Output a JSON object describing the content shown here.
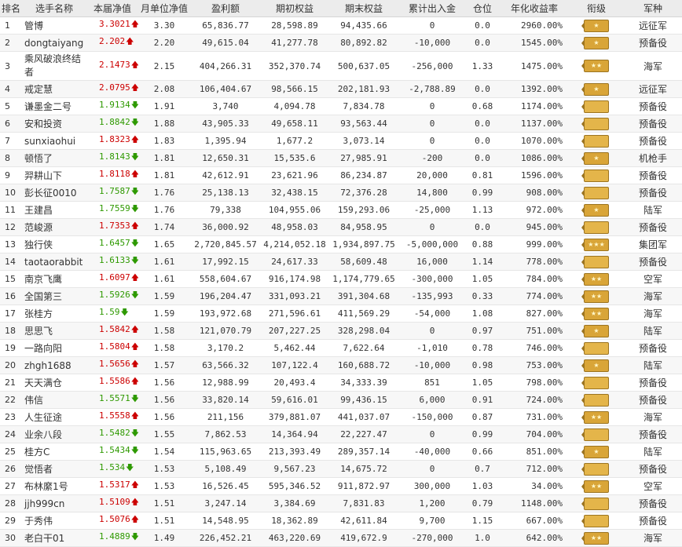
{
  "headers": [
    "排名",
    "选手名称",
    "本届净值",
    "月单位净值",
    "盈利额",
    "期初权益",
    "期末权益",
    "累计出入金",
    "仓位",
    "年化收益率",
    "衔级",
    "军种"
  ],
  "rows": [
    {
      "rank": "1",
      "name": "管博",
      "nav": "3.3021",
      "trend": "up",
      "arrow": "🡅",
      "monthly": "3.30",
      "profit": "65,836.77",
      "start": "28,598.89",
      "end": "94,435.66",
      "flow": "0",
      "pos": "0.0",
      "annual": "2960.00%",
      "army": "远征军",
      "badge": "★",
      "tall": false
    },
    {
      "rank": "2",
      "name": "dongtaiyang",
      "nav": "2.202",
      "trend": "up",
      "arrow": "🡅",
      "monthly": "2.20",
      "profit": "49,615.04",
      "start": "41,277.78",
      "end": "80,892.82",
      "flow": "-10,000",
      "pos": "0.0",
      "annual": "1545.00%",
      "army": "预备役",
      "badge": "★",
      "tall": false
    },
    {
      "rank": "3",
      "name": "乘风破浪终结者",
      "nav": "2.1473",
      "trend": "up",
      "arrow": "🡅",
      "monthly": "2.15",
      "profit": "404,266.31",
      "start": "352,370.74",
      "end": "500,637.05",
      "flow": "-256,000",
      "pos": "1.33",
      "annual": "1475.00%",
      "army": "海军",
      "badge": "★★",
      "tall": true
    },
    {
      "rank": "4",
      "name": "戒定慧",
      "nav": "2.0795",
      "trend": "up",
      "arrow": "🡅",
      "monthly": "2.08",
      "profit": "106,404.67",
      "start": "98,566.15",
      "end": "202,181.93",
      "flow": "-2,788.89",
      "pos": "0.0",
      "annual": "1392.00%",
      "army": "远征军",
      "badge": "★",
      "tall": false
    },
    {
      "rank": "5",
      "name": "谦墨金二号",
      "nav": "1.9134",
      "trend": "down",
      "arrow": "🡇",
      "monthly": "1.91",
      "profit": "3,740",
      "start": "4,094.78",
      "end": "7,834.78",
      "flow": "0",
      "pos": "0.68",
      "annual": "1174.00%",
      "army": "预备役",
      "badge": "",
      "tall": false
    },
    {
      "rank": "6",
      "name": "安和投资",
      "nav": "1.8842",
      "trend": "down",
      "arrow": "🡇",
      "monthly": "1.88",
      "profit": "43,905.33",
      "start": "49,658.11",
      "end": "93,563.44",
      "flow": "0",
      "pos": "0.0",
      "annual": "1137.00%",
      "army": "预备役",
      "badge": "",
      "tall": false
    },
    {
      "rank": "7",
      "name": "sunxiaohui",
      "nav": "1.8323",
      "trend": "up",
      "arrow": "🡅",
      "monthly": "1.83",
      "profit": "1,395.94",
      "start": "1,677.2",
      "end": "3,073.14",
      "flow": "0",
      "pos": "0.0",
      "annual": "1070.00%",
      "army": "预备役",
      "badge": "",
      "tall": false
    },
    {
      "rank": "8",
      "name": "顿悟了",
      "nav": "1.8143",
      "trend": "down",
      "arrow": "🡇",
      "monthly": "1.81",
      "profit": "12,650.31",
      "start": "15,535.6",
      "end": "27,985.91",
      "flow": "-200",
      "pos": "0.0",
      "annual": "1086.00%",
      "army": "机枪手",
      "badge": "★",
      "tall": false
    },
    {
      "rank": "9",
      "name": "羿耕山下",
      "nav": "1.8118",
      "trend": "up",
      "arrow": "🡅",
      "monthly": "1.81",
      "profit": "42,612.91",
      "start": "23,621.96",
      "end": "86,234.87",
      "flow": "20,000",
      "pos": "0.81",
      "annual": "1596.00%",
      "army": "预备役",
      "badge": "",
      "tall": false
    },
    {
      "rank": "10",
      "name": "彭长征0010",
      "nav": "1.7587",
      "trend": "down",
      "arrow": "🡇",
      "monthly": "1.76",
      "profit": "25,138.13",
      "start": "32,438.15",
      "end": "72,376.28",
      "flow": "14,800",
      "pos": "0.99",
      "annual": "908.00%",
      "army": "预备役",
      "badge": "",
      "tall": false
    },
    {
      "rank": "11",
      "name": "王建昌",
      "nav": "1.7559",
      "trend": "down",
      "arrow": "🡇",
      "monthly": "1.76",
      "profit": "79,338",
      "start": "104,955.06",
      "end": "159,293.06",
      "flow": "-25,000",
      "pos": "1.13",
      "annual": "972.00%",
      "army": "陆军",
      "badge": "★",
      "tall": false
    },
    {
      "rank": "12",
      "name": "范峻源",
      "nav": "1.7353",
      "trend": "up",
      "arrow": "🡅",
      "monthly": "1.74",
      "profit": "36,000.92",
      "start": "48,958.03",
      "end": "84,958.95",
      "flow": "0",
      "pos": "0.0",
      "annual": "945.00%",
      "army": "预备役",
      "badge": "",
      "tall": false
    },
    {
      "rank": "13",
      "name": "独行侠",
      "nav": "1.6457",
      "trend": "down",
      "arrow": "🡇",
      "monthly": "1.65",
      "profit": "2,720,845.57",
      "start": "4,214,052.18",
      "end": "1,934,897.75",
      "flow": "-5,000,000",
      "pos": "0.88",
      "annual": "999.00%",
      "army": "集团军",
      "badge": "★★★",
      "tall": false
    },
    {
      "rank": "14",
      "name": "taotaorabbit",
      "nav": "1.6133",
      "trend": "down",
      "arrow": "🡇",
      "monthly": "1.61",
      "profit": "17,992.15",
      "start": "24,617.33",
      "end": "58,609.48",
      "flow": "16,000",
      "pos": "1.14",
      "annual": "778.00%",
      "army": "预备役",
      "badge": "",
      "tall": false
    },
    {
      "rank": "15",
      "name": "南京飞鹰",
      "nav": "1.6097",
      "trend": "up",
      "arrow": "🡅",
      "monthly": "1.61",
      "profit": "558,604.67",
      "start": "916,174.98",
      "end": "1,174,779.65",
      "flow": "-300,000",
      "pos": "1.05",
      "annual": "784.00%",
      "army": "空军",
      "badge": "★★",
      "tall": false
    },
    {
      "rank": "16",
      "name": "全国第三",
      "nav": "1.5926",
      "trend": "down",
      "arrow": "🡇",
      "monthly": "1.59",
      "profit": "196,204.47",
      "start": "331,093.21",
      "end": "391,304.68",
      "flow": "-135,993",
      "pos": "0.33",
      "annual": "774.00%",
      "army": "海军",
      "badge": "★★",
      "tall": false
    },
    {
      "rank": "17",
      "name": "张桂方",
      "nav": "1.59",
      "trend": "down",
      "arrow": "🡇",
      "monthly": "1.59",
      "profit": "193,972.68",
      "start": "271,596.61",
      "end": "411,569.29",
      "flow": "-54,000",
      "pos": "1.08",
      "annual": "827.00%",
      "army": "海军",
      "badge": "★★",
      "tall": false
    },
    {
      "rank": "18",
      "name": "思思飞",
      "nav": "1.5842",
      "trend": "up",
      "arrow": "🡅",
      "monthly": "1.58",
      "profit": "121,070.79",
      "start": "207,227.25",
      "end": "328,298.04",
      "flow": "0",
      "pos": "0.97",
      "annual": "751.00%",
      "army": "陆军",
      "badge": "★",
      "tall": false
    },
    {
      "rank": "19",
      "name": "一路向阳",
      "nav": "1.5804",
      "trend": "up",
      "arrow": "🡅",
      "monthly": "1.58",
      "profit": "3,170.2",
      "start": "5,462.44",
      "end": "7,622.64",
      "flow": "-1,010",
      "pos": "0.78",
      "annual": "746.00%",
      "army": "预备役",
      "badge": "",
      "tall": false
    },
    {
      "rank": "20",
      "name": "zhgh1688",
      "nav": "1.5656",
      "trend": "up",
      "arrow": "🡅",
      "monthly": "1.57",
      "profit": "63,566.32",
      "start": "107,122.4",
      "end": "160,688.72",
      "flow": "-10,000",
      "pos": "0.98",
      "annual": "753.00%",
      "army": "陆军",
      "badge": "★",
      "tall": false
    },
    {
      "rank": "21",
      "name": "天天满仓",
      "nav": "1.5586",
      "trend": "up",
      "arrow": "🡅",
      "monthly": "1.56",
      "profit": "12,988.99",
      "start": "20,493.4",
      "end": "34,333.39",
      "flow": "851",
      "pos": "1.05",
      "annual": "798.00%",
      "army": "预备役",
      "badge": "",
      "tall": false
    },
    {
      "rank": "22",
      "name": "伟信",
      "nav": "1.5571",
      "trend": "down",
      "arrow": "🡇",
      "monthly": "1.56",
      "profit": "33,820.14",
      "start": "59,616.01",
      "end": "99,436.15",
      "flow": "6,000",
      "pos": "0.91",
      "annual": "724.00%",
      "army": "预备役",
      "badge": "",
      "tall": false
    },
    {
      "rank": "23",
      "name": "人生征途",
      "nav": "1.5558",
      "trend": "up",
      "arrow": "🡅",
      "monthly": "1.56",
      "profit": "211,156",
      "start": "379,881.07",
      "end": "441,037.07",
      "flow": "-150,000",
      "pos": "0.87",
      "annual": "731.00%",
      "army": "海军",
      "badge": "★★",
      "tall": false
    },
    {
      "rank": "24",
      "name": "业余八段",
      "nav": "1.5482",
      "trend": "down",
      "arrow": "🡇",
      "monthly": "1.55",
      "profit": "7,862.53",
      "start": "14,364.94",
      "end": "22,227.47",
      "flow": "0",
      "pos": "0.99",
      "annual": "704.00%",
      "army": "预备役",
      "badge": "",
      "tall": false
    },
    {
      "rank": "25",
      "name": "桂方C",
      "nav": "1.5434",
      "trend": "down",
      "arrow": "🡇",
      "monthly": "1.54",
      "profit": "115,963.65",
      "start": "213,393.49",
      "end": "289,357.14",
      "flow": "-40,000",
      "pos": "0.66",
      "annual": "851.00%",
      "army": "陆军",
      "badge": "★",
      "tall": false
    },
    {
      "rank": "26",
      "name": "觉悟者",
      "nav": "1.534",
      "trend": "down",
      "arrow": "🡇",
      "monthly": "1.53",
      "profit": "5,108.49",
      "start": "9,567.23",
      "end": "14,675.72",
      "flow": "0",
      "pos": "0.7",
      "annual": "712.00%",
      "army": "预备役",
      "badge": "",
      "tall": false
    },
    {
      "rank": "27",
      "name": "布林縻1号",
      "nav": "1.5317",
      "trend": "up",
      "arrow": "🡅",
      "monthly": "1.53",
      "profit": "16,526.45",
      "start": "595,346.52",
      "end": "911,872.97",
      "flow": "300,000",
      "pos": "1.03",
      "annual": "34.00%",
      "army": "空军",
      "badge": "★★",
      "tall": false
    },
    {
      "rank": "28",
      "name": "jjh999cn",
      "nav": "1.5109",
      "trend": "up",
      "arrow": "🡅",
      "monthly": "1.51",
      "profit": "3,247.14",
      "start": "3,384.69",
      "end": "7,831.83",
      "flow": "1,200",
      "pos": "0.79",
      "annual": "1148.00%",
      "army": "预备役",
      "badge": "",
      "tall": false
    },
    {
      "rank": "29",
      "name": "于秀伟",
      "nav": "1.5076",
      "trend": "up",
      "arrow": "🡅",
      "monthly": "1.51",
      "profit": "14,548.95",
      "start": "18,362.89",
      "end": "42,611.84",
      "flow": "9,700",
      "pos": "1.15",
      "annual": "667.00%",
      "army": "预备役",
      "badge": "",
      "tall": false
    },
    {
      "rank": "30",
      "name": "老白干01",
      "nav": "1.4889",
      "trend": "down",
      "arrow": "🡇",
      "monthly": "1.49",
      "profit": "226,452.21",
      "start": "463,220.69",
      "end": "419,672.9",
      "flow": "-270,000",
      "pos": "1.0",
      "annual": "642.00%",
      "army": "海军",
      "badge": "★★",
      "tall": false
    }
  ],
  "colors": {
    "up": "#cc0000",
    "down": "#2e9900",
    "badge": "#d9a538"
  }
}
